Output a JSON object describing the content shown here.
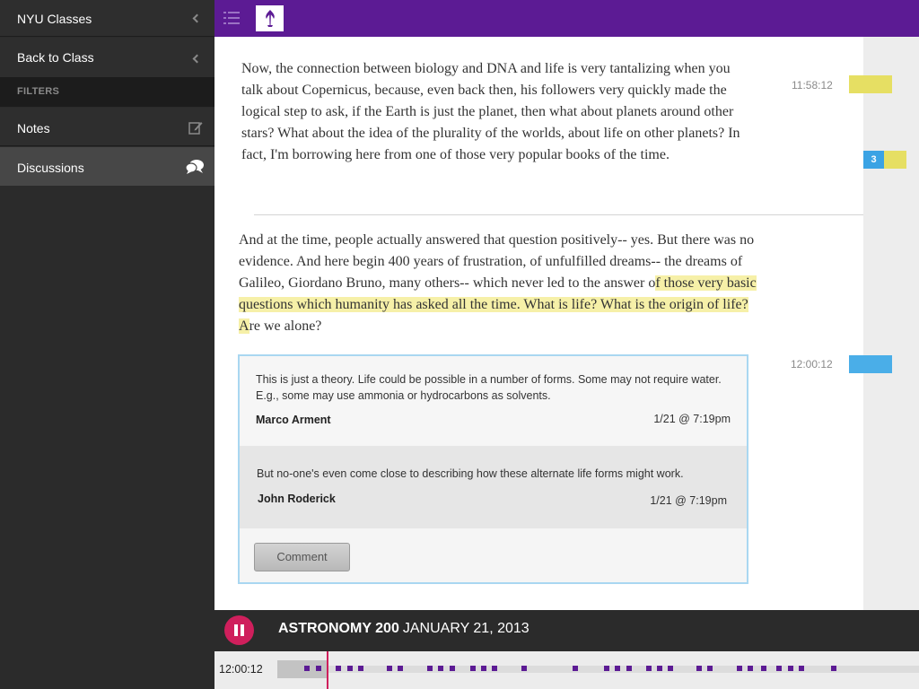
{
  "sidebar": {
    "nyu_classes": "NYU Classes",
    "back_to_class": "Back to Class",
    "filters_heading": "FILTERS",
    "notes": "Notes",
    "discussions": "Discussions"
  },
  "content": {
    "paragraph1": "Now, the connection between biology and DNA and life is very tantalizing when you talk about Copernicus, because, even back then, his followers very quickly made the logical step to ask, if the Earth is just the planet, then what about planets around other stars? What about the idea of the plurality of the worlds, about life on other planets? In fact, I'm borrowing here from one of those very popular books of the time.",
    "paragraph2_before": "And at the time, people actually answered that question positively-- yes. But there was no evidence. And here begin 400 years of frustration, of unfulfilled dreams-- the dreams of Galileo, Giordano Bruno, many others-- which never led to the answer o",
    "paragraph2_highlight": "f those very basic questions which humanity has asked all the time. What is life? What is the origin of life? A",
    "paragraph2_after": "re we alone?",
    "timestamp1": "11:58:12",
    "timestamp2": "12:00:12",
    "marker_count": "3"
  },
  "discussion": {
    "comments": [
      {
        "text": "This is just a theory. Life could be possible in a number of forms. Some may not require water. E.g., some may use ammonia or hydrocarbons as solvents.",
        "author": "Marco Arment",
        "date": "1/21 @ 7:19pm"
      },
      {
        "text": "But no-one's even come close to describing how these alternate life forms might work.",
        "author": "John Roderick",
        "date": "1/21 @ 7:19pm"
      }
    ],
    "comment_button": "Comment"
  },
  "player": {
    "course": "ASTRONOMY 200",
    "date": "JANUARY 21, 2013",
    "current_time": "12:00:12"
  },
  "colors": {
    "brand_purple": "#5c1b94",
    "pause_red": "#cf1f5c",
    "highlight_yellow": "#e6df63",
    "discussion_blue": "#4aaee8"
  }
}
